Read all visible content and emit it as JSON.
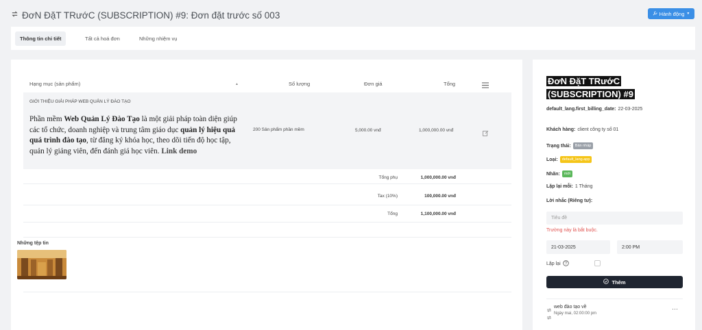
{
  "header": {
    "title": "ĐơN ĐặT TRướC (SUBSCRIPTION) #9: Đơn đặt trước số 003",
    "action_label": "Hành động"
  },
  "tabs": [
    {
      "label": "Thông tin chi tiết"
    },
    {
      "label": "Tất cả hoá đơn"
    },
    {
      "label": "Những nhiệm vụ"
    }
  ],
  "table": {
    "headers": {
      "item": "Hạng mục (sản phẩm)",
      "sort_arrow": "▲",
      "qty": "Số lượng",
      "price": "Đơn giá",
      "total": "Tổng"
    },
    "item": {
      "title": "GIỚI THIỆU GIẢI PHÁP WEB QUẢN LÝ ĐÀO TẠO",
      "desc": {
        "p1": "Phần mềm ",
        "b1": "Web Quản Lý Đào Tạo",
        "p2": " là một giải pháp toàn diện giúp các tổ chức, doanh nghiệp và trung tâm giáo dục ",
        "b2": "quản lý hiệu quả quá trình đào tạo",
        "p3": ", từ đăng ký khóa học, theo dõi tiến độ học tập, quản lý giảng viên, đến đánh giá học viên. ",
        "link": "Link demo"
      },
      "qty": "200 Sản phẩm phần mềm",
      "price": "5,000.00 vnđ",
      "total": "1,000,000.00 vnđ"
    },
    "summary": [
      {
        "label": "Tổng phụ",
        "value": "1,000,000.00 vnđ"
      },
      {
        "label": "Tax (10%)",
        "value": "100,000.00 vnđ"
      },
      {
        "label": "Tổng",
        "value": "1,100,000.00 vnđ"
      }
    ]
  },
  "files": {
    "label": "Những tệp tin"
  },
  "side": {
    "title": "ĐơN ĐặT TRướC (SUBSCRIPTION) #9",
    "billing_label": "default_lang.first_billing_date:",
    "billing_value": "22-03-2025",
    "client_label": "Khách hàng:",
    "client_value": "client công ty số 01",
    "status_label": "Trạng thái:",
    "status_badge": "Bản nháp",
    "type_label": "Loại:",
    "type_badge": "default_lang.app",
    "tag_label": "Nhãn:",
    "tag_badge": "mới",
    "repeat_every_label": "Lặp lại mỗi:",
    "repeat_every_value": "1 Tháng",
    "reminder_label": "Lời nhắc (Riêng tư):",
    "title_placeholder": "Tiêu đề",
    "required_error": "Trường này là bắt buộc.",
    "date_value": "21-03-2025",
    "time_value": "2:00 PM",
    "repeat_label": "Lặp lại",
    "add_button": "Thêm",
    "reminder": {
      "title": "web đào tạo về",
      "time": "Ngày mai, 02:00:00 pm",
      "more": "···"
    }
  },
  "colors": {
    "primary": "#3b8fe6",
    "badge_draft": "#9aa0a8",
    "badge_app": "#f5c518",
    "badge_new": "#5cb85c",
    "error": "#e0504d",
    "dark_button": "#1f2530"
  }
}
